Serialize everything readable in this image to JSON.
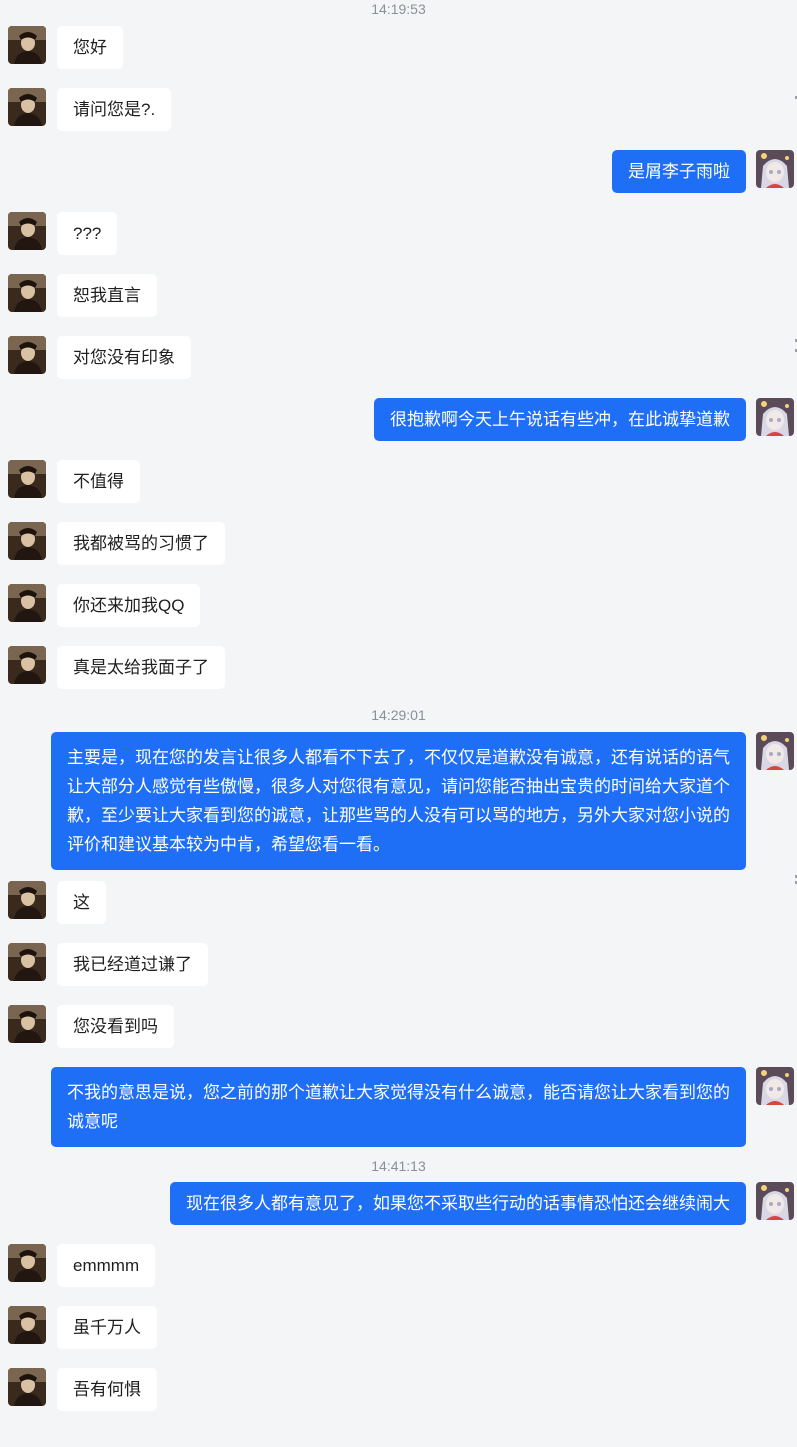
{
  "conversation": {
    "timestamps": [
      "14:19:53",
      "14:29:01",
      "14:41:13"
    ],
    "messages": [
      {
        "from": "other",
        "text": "您好"
      },
      {
        "from": "other",
        "text": "请问您是?."
      },
      {
        "from": "self",
        "text": "是屑李子雨啦"
      },
      {
        "from": "other",
        "text": "???"
      },
      {
        "from": "other",
        "text": "恕我直言"
      },
      {
        "from": "other",
        "text": "对您没有印象"
      },
      {
        "from": "self",
        "text": "很抱歉啊今天上午说话有些冲，在此诚挚道歉"
      },
      {
        "from": "other",
        "text": "不值得"
      },
      {
        "from": "other",
        "text": "我都被骂的习惯了"
      },
      {
        "from": "other",
        "text": "你还来加我QQ"
      },
      {
        "from": "other",
        "text": "真是太给我面子了"
      },
      {
        "from": "self",
        "text": "主要是，现在您的发言让很多人都看不下去了，不仅仅是道歉没有诚意，还有说话的语气让大部分人感觉有些傲慢，很多人对您很有意见，请问您能否抽出宝贵的时间给大家道个歉，至少要让大家看到您的诚意，让那些骂的人没有可以骂的地方，另外大家对您小说的评价和建议基本较为中肯，希望您看一看。"
      },
      {
        "from": "other",
        "text": "这"
      },
      {
        "from": "other",
        "text": "我已经道过谦了"
      },
      {
        "from": "other",
        "text": "您没看到吗"
      },
      {
        "from": "self",
        "text": "不我的意思是说，您之前的那个道歉让大家觉得没有什么诚意，能否请您让大家看到您的诚意呢"
      },
      {
        "from": "self",
        "text": "现在很多人都有意见了，如果您不采取些行动的话事情恐怕还会继续闹大"
      },
      {
        "from": "other",
        "text": "emmmm"
      },
      {
        "from": "other",
        "text": "虽千万人"
      },
      {
        "from": "other",
        "text": "吾有何惧"
      }
    ]
  },
  "avatars": {
    "other": {
      "icon": "portrait-man-icon",
      "colors": [
        "#3a2a1e",
        "#7a6650",
        "#d9c2a3"
      ]
    },
    "self": {
      "icon": "anime-girl-avatar-icon",
      "colors": [
        "#f1e9e6",
        "#a8a9c8",
        "#d6473c"
      ]
    }
  },
  "colors": {
    "background": "#f4f5f7",
    "incoming_bubble": "#ffffff",
    "outgoing_bubble": "#1e6ff5",
    "timestamp_text": "#8a8f98"
  }
}
